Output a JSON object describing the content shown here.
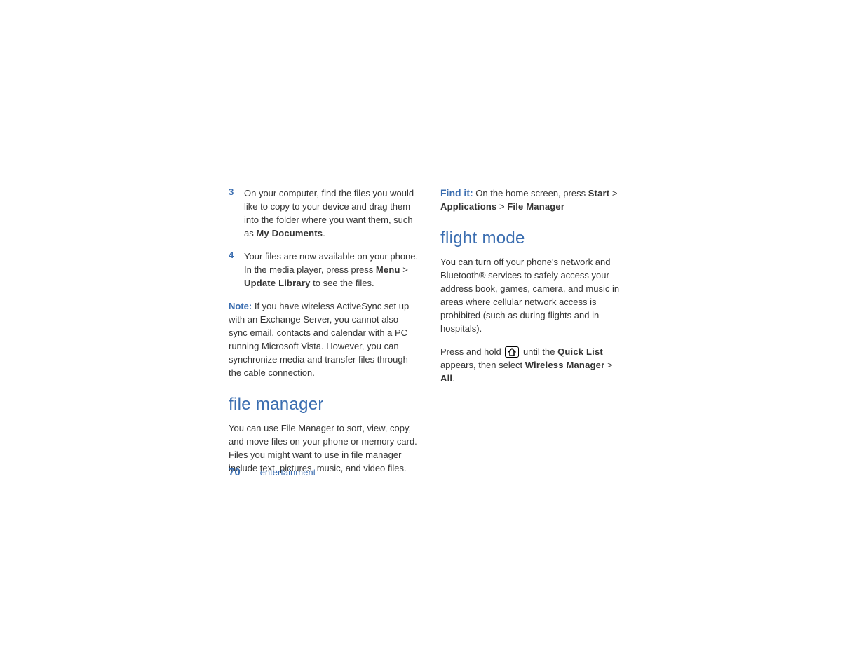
{
  "left": {
    "item3": {
      "num": "3",
      "text_a": "On your computer, find the files you would like to copy to your device and drag them into the folder where you want them, such as ",
      "bold_a": "My Documents",
      "text_b": "."
    },
    "item4": {
      "num": "4",
      "text_a": "Your files are now available on your phone. In the media player, press press ",
      "bold_a": "Menu",
      "sep_a": " > ",
      "bold_b": "Update Library",
      "text_b": " to see the files."
    },
    "note": {
      "label": "Note:",
      "text": " If you have wireless ActiveSync set up with an Exchange Server, you cannot also sync email, contacts and calendar with a PC running Microsoft Vista. However, you can synchronize media and transfer files through the cable connection."
    },
    "heading_fm": "file manager",
    "fm_text": "You can use File Manager to sort, view, copy, and move files on your phone or memory card. Files you might want to use in file manager include text, pictures, music, and video files."
  },
  "right": {
    "find": {
      "label": "Find it:",
      "text_a": " On the home screen, press ",
      "bold_a": "Start",
      "sep_a": " > ",
      "bold_b": "Applications",
      "sep_b": " > ",
      "bold_c": "File Manager"
    },
    "heading_flight": "flight mode",
    "flight_text": "You can turn off your phone's network and Bluetooth® services to safely access your address book, games, camera, and music in areas where cellular network access is prohibited (such as during flights and in hospitals).",
    "press": {
      "text_a": "Press and hold ",
      "text_b": " until the ",
      "bold_a": "Quick List",
      "text_c": " appears, then select ",
      "bold_b": "Wireless Manager",
      "sep_a": " > ",
      "bold_c": "All",
      "text_d": "."
    }
  },
  "footer": {
    "page": "70",
    "section": "entertainment"
  }
}
